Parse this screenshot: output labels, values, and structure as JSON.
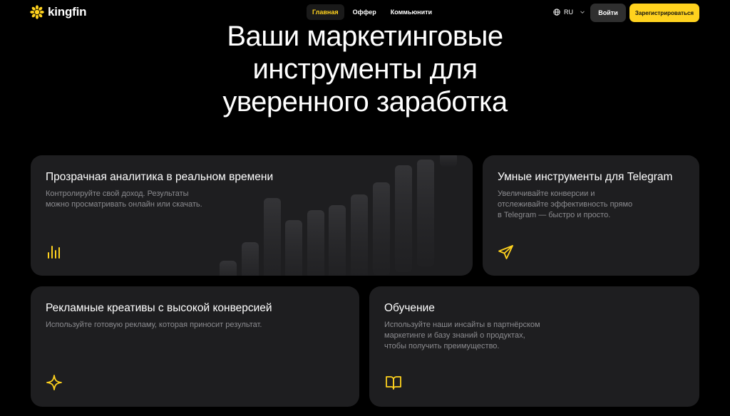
{
  "brand": {
    "name": "kingfin"
  },
  "nav": {
    "links": [
      {
        "label": "Главная",
        "active": true
      },
      {
        "label": "Оффер",
        "active": false
      },
      {
        "label": "Коммьюнити",
        "active": false
      }
    ],
    "language": "RU",
    "login_label": "Войти",
    "register_label": "Зарегистрироваться"
  },
  "hero": {
    "line1": "Ваши маркетинговые",
    "line2": "инструменты для",
    "line3": "уверенного заработка"
  },
  "cards": {
    "analytics": {
      "title": "Прозрачная аналитика в реальном времени",
      "desc1": "Контролируйте свой доход. Результаты",
      "desc2": "можно просматривать онлайн или скачать.",
      "icon": "bar-chart-icon"
    },
    "telegram": {
      "title": "Умные инструменты для Telegram",
      "desc1": "Увеличивайте конверсии и",
      "desc2": "отслеживайте эффективность прямо",
      "desc3": "в Telegram — быстро и просто.",
      "icon": "send-icon"
    },
    "creatives": {
      "title": "Рекламные креативы с высокой конверсией",
      "desc1": "Используйте готовую рекламу, которая приносит результат.",
      "icon": "sparkle-icon"
    },
    "learning": {
      "title": "Обучение",
      "desc1": "Используйте наши инсайты в партнёрском",
      "desc2": "маркетинге и базу знаний о продуктах,",
      "desc3": "чтобы получить преимущество.",
      "icon": "book-icon"
    }
  },
  "colors": {
    "accent": "#ffd21e",
    "card": "#1e1e20",
    "background": "#000000",
    "muted_text": "#8c8c90"
  }
}
